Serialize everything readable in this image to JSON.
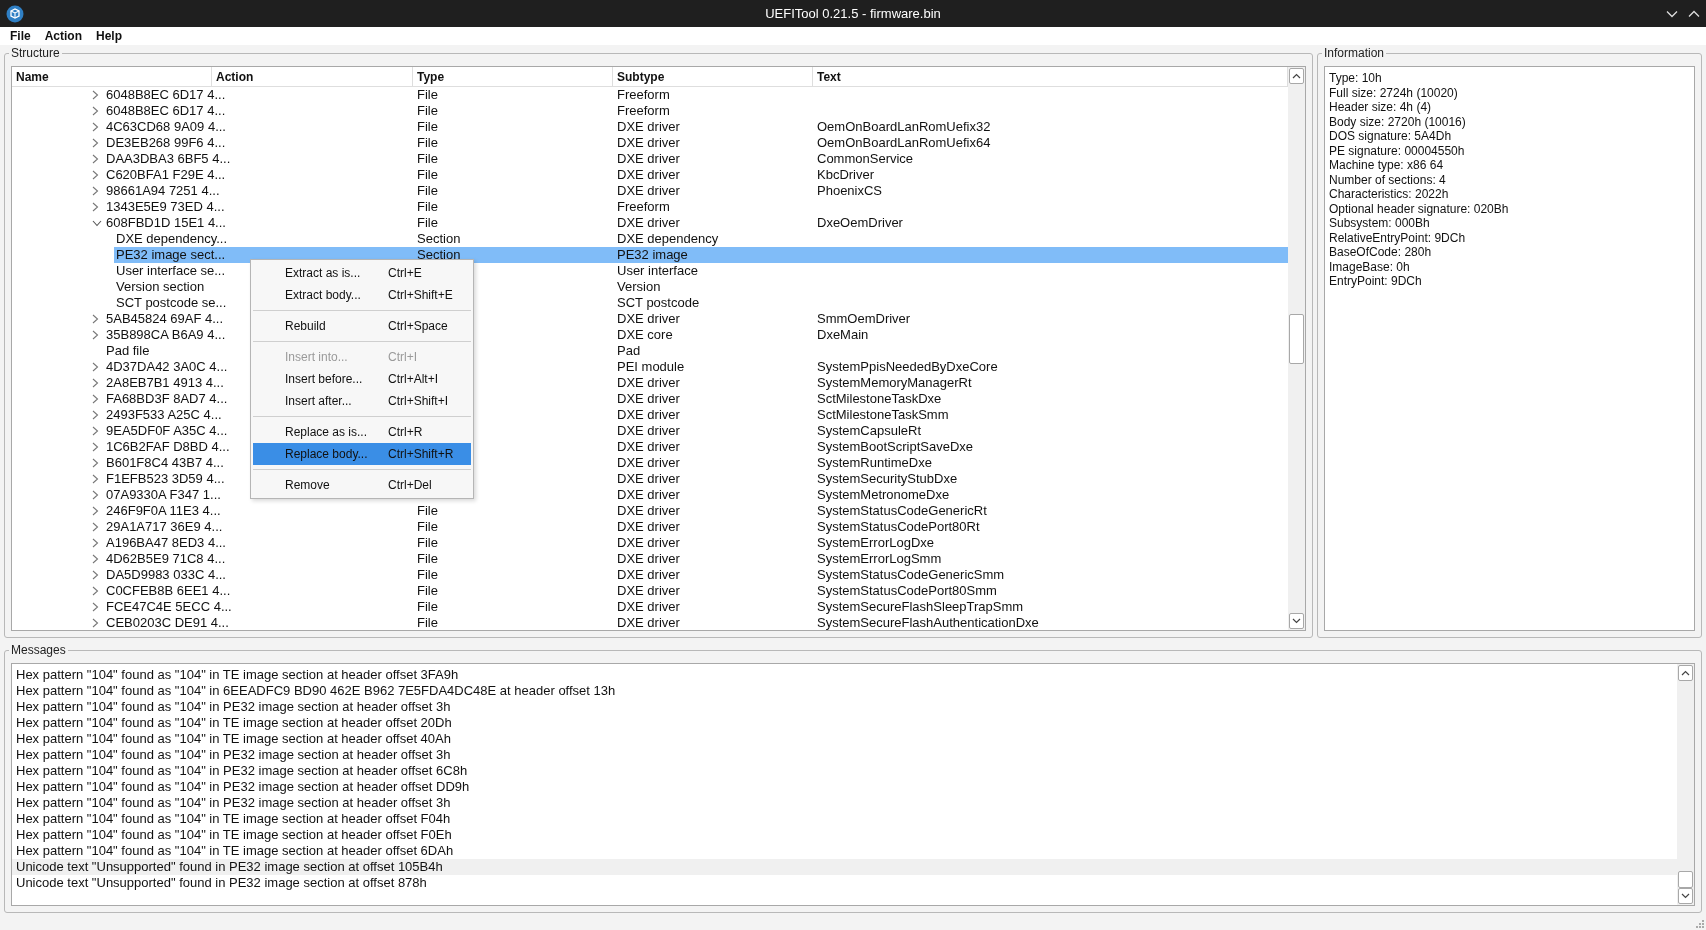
{
  "window": {
    "title": "UEFITool 0.21.5 - firmware.bin"
  },
  "menu_bar": [
    {
      "label": "File"
    },
    {
      "label": "Action"
    },
    {
      "label": "Help"
    }
  ],
  "structure": {
    "title": "Structure",
    "columns": [
      "Name",
      "Action",
      "Type",
      "Subtype",
      "Text"
    ],
    "rows": [
      {
        "name": "6048B8EC 6D17 4...",
        "type": "File",
        "subtype": "Freeform",
        "expanded": false,
        "selected": false
      },
      {
        "name": "6048B8EC 6D17 4...",
        "type": "File",
        "subtype": "Freeform",
        "expanded": false,
        "selected": false
      },
      {
        "name": "4C63CD68 9A09 4...",
        "type": "File",
        "subtype": "DXE driver",
        "text": "OemOnBoardLanRomUefix32",
        "expanded": false,
        "selected": false
      },
      {
        "name": "DE3EB268 99F6 4...",
        "type": "File",
        "subtype": "DXE driver",
        "text": "OemOnBoardLanRomUefix64",
        "expanded": false,
        "selected": false
      },
      {
        "name": "DAA3DBA3 6BF5 4...",
        "type": "File",
        "subtype": "DXE driver",
        "text": "CommonService",
        "expanded": false,
        "selected": false
      },
      {
        "name": "C620BFA1 F29E 4...",
        "type": "File",
        "subtype": "DXE driver",
        "text": "KbcDriver",
        "expanded": false,
        "selected": false
      },
      {
        "name": "98661A94 7251 4...",
        "type": "File",
        "subtype": "DXE driver",
        "text": "PhoenixCS",
        "expanded": false,
        "selected": false
      },
      {
        "name": "1343E5E9 73ED 4...",
        "type": "File",
        "subtype": "Freeform",
        "expanded": false,
        "selected": false
      },
      {
        "name": "608FBD1D 15E1 4...",
        "type": "File",
        "subtype": "DXE driver",
        "text": "DxeOemDriver",
        "expanded": true,
        "selected": false,
        "children": [
          {
            "name": "DXE dependency...",
            "type": "Section",
            "subtype": "DXE dependency",
            "selected": false
          },
          {
            "name": "PE32 image sect...",
            "type": "Section",
            "subtype": "PE32 image",
            "selected": true
          },
          {
            "name": "User interface se...",
            "subtype": "User interface",
            "selected": false
          },
          {
            "name": "Version section",
            "subtype": "Version",
            "selected": false
          },
          {
            "name": "SCT postcode se...",
            "subtype": "SCT postcode",
            "selected": false
          }
        ]
      },
      {
        "name": "5AB45824 69AF 4...",
        "subtype": "DXE driver",
        "text": "SmmOemDriver",
        "expanded": false,
        "selected": false
      },
      {
        "name": "35B898CA B6A9 4...",
        "subtype": "DXE core",
        "text": "DxeMain",
        "expanded": false,
        "selected": false
      },
      {
        "name": "Pad file",
        "subtype": "Pad",
        "selected": false
      },
      {
        "name": "4D37DA42 3A0C 4...",
        "subtype": "PEI module",
        "text": "SystemPpisNeededByDxeCore",
        "expanded": false,
        "selected": false
      },
      {
        "name": "2A8EB7B1 4913 4...",
        "subtype": "DXE driver",
        "text": "SystemMemoryManagerRt",
        "expanded": false,
        "selected": false
      },
      {
        "name": "FA68BD3F 8AD7 4...",
        "subtype": "DXE driver",
        "text": "SctMilestoneTaskDxe",
        "expanded": false,
        "selected": false
      },
      {
        "name": "2493F533 A25C 4...",
        "subtype": "DXE driver",
        "text": "SctMilestoneTaskSmm",
        "expanded": false,
        "selected": false
      },
      {
        "name": "9EA5DF0F A35C 4...",
        "subtype": "DXE driver",
        "text": "SystemCapsuleRt",
        "expanded": false,
        "selected": false
      },
      {
        "name": "1C6B2FAF D8BD 4...",
        "subtype": "DXE driver",
        "text": "SystemBootScriptSaveDxe",
        "expanded": false,
        "selected": false
      },
      {
        "name": "B601F8C4 43B7 4...",
        "subtype": "DXE driver",
        "text": "SystemRuntimeDxe",
        "expanded": false,
        "selected": false
      },
      {
        "name": "F1EFB523 3D59 4...",
        "subtype": "DXE driver",
        "text": "SystemSecurityStubDxe",
        "expanded": false,
        "selected": false
      },
      {
        "name": "07A9330A F347 1...",
        "subtype": "DXE driver",
        "text": "SystemMetronomeDxe",
        "expanded": false,
        "selected": false
      },
      {
        "name": "246F9F0A 11E3 4...",
        "type": "File",
        "subtype": "DXE driver",
        "text": "SystemStatusCodeGenericRt",
        "expanded": false,
        "selected": false
      },
      {
        "name": "29A1A717 36E9 4...",
        "type": "File",
        "subtype": "DXE driver",
        "text": "SystemStatusCodePort80Rt",
        "expanded": false,
        "selected": false
      },
      {
        "name": "A196BA47 8ED3 4...",
        "type": "File",
        "subtype": "DXE driver",
        "text": "SystemErrorLogDxe",
        "expanded": false,
        "selected": false
      },
      {
        "name": "4D62B5E9 71C8 4...",
        "type": "File",
        "subtype": "DXE driver",
        "text": "SystemErrorLogSmm",
        "expanded": false,
        "selected": false
      },
      {
        "name": "DA5D9983 033C 4...",
        "type": "File",
        "subtype": "DXE driver",
        "text": "SystemStatusCodeGenericSmm",
        "expanded": false,
        "selected": false
      },
      {
        "name": "C0CFEB8B 6EE1 4...",
        "type": "File",
        "subtype": "DXE driver",
        "text": "SystemStatusCodePort80Smm",
        "expanded": false,
        "selected": false
      },
      {
        "name": "FCE47C4E 5ECC 4...",
        "type": "File",
        "subtype": "DXE driver",
        "text": "SystemSecureFlashSleepTrapSmm",
        "expanded": false,
        "selected": false
      },
      {
        "name": "CEB0203C DE91 4...",
        "type": "File",
        "subtype": "DXE driver",
        "text": "SystemSecureFlashAuthenticationDxe",
        "expanded": false,
        "selected": false
      }
    ]
  },
  "context_menu": [
    {
      "kind": "item",
      "label": "Extract as is...",
      "shortcut": "Ctrl+E",
      "disabled": false,
      "selected": false
    },
    {
      "kind": "item",
      "label": "Extract body...",
      "shortcut": "Ctrl+Shift+E",
      "disabled": false,
      "selected": false
    },
    {
      "kind": "separator"
    },
    {
      "kind": "item",
      "label": "Rebuild",
      "shortcut": "Ctrl+Space",
      "disabled": false,
      "selected": false
    },
    {
      "kind": "separator"
    },
    {
      "kind": "item",
      "label": "Insert into...",
      "shortcut": "Ctrl+I",
      "disabled": true,
      "selected": false
    },
    {
      "kind": "item",
      "label": "Insert before...",
      "shortcut": "Ctrl+Alt+I",
      "disabled": false,
      "selected": false
    },
    {
      "kind": "item",
      "label": "Insert after...",
      "shortcut": "Ctrl+Shift+I",
      "disabled": false,
      "selected": false
    },
    {
      "kind": "separator"
    },
    {
      "kind": "item",
      "label": "Replace as is...",
      "shortcut": "Ctrl+R",
      "disabled": false,
      "selected": false
    },
    {
      "kind": "item",
      "label": "Replace body...",
      "shortcut": "Ctrl+Shift+R",
      "disabled": false,
      "selected": true
    },
    {
      "kind": "separator"
    },
    {
      "kind": "item",
      "label": "Remove",
      "shortcut": "Ctrl+Del",
      "disabled": false,
      "selected": false
    }
  ],
  "information": {
    "title": "Information",
    "lines": [
      "Type: 10h",
      "Full size: 2724h (10020)",
      "Header size: 4h (4)",
      "Body size: 2720h (10016)",
      "DOS signature: 5A4Dh",
      "PE signature: 00004550h",
      "Machine type: x86 64",
      "Number of sections: 4",
      "Characteristics: 2022h",
      "Optional header signature: 020Bh",
      "Subsystem: 000Bh",
      "RelativeEntryPoint: 9DCh",
      "BaseOfCode: 280h",
      "ImageBase: 0h",
      "EntryPoint: 9DCh"
    ]
  },
  "messages": {
    "title": "Messages",
    "items": [
      {
        "text": "Hex pattern \"104\" found as \"104\" in TE image section at header offset 3FA9h",
        "selected": false
      },
      {
        "text": "Hex pattern \"104\" found as \"104\" in 6EEADFC9 BD90 462E B962 7E5FDA4DC48E at header offset 13h",
        "selected": false
      },
      {
        "text": "Hex pattern \"104\" found as \"104\" in PE32 image section at header offset 3h",
        "selected": false
      },
      {
        "text": "Hex pattern \"104\" found as \"104\" in TE image section at header offset 20Dh",
        "selected": false
      },
      {
        "text": "Hex pattern \"104\" found as \"104\" in TE image section at header offset 40Ah",
        "selected": false
      },
      {
        "text": "Hex pattern \"104\" found as \"104\" in PE32 image section at header offset 3h",
        "selected": false
      },
      {
        "text": "Hex pattern \"104\" found as \"104\" in PE32 image section at header offset 6C8h",
        "selected": false
      },
      {
        "text": "Hex pattern \"104\" found as \"104\" in PE32 image section at header offset DD9h",
        "selected": false
      },
      {
        "text": "Hex pattern \"104\" found as \"104\" in PE32 image section at header offset 3h",
        "selected": false
      },
      {
        "text": "Hex pattern \"104\" found as \"104\" in TE image section at header offset F04h",
        "selected": false
      },
      {
        "text": "Hex pattern \"104\" found as \"104\" in TE image section at header offset F0Eh",
        "selected": false
      },
      {
        "text": "Hex pattern \"104\" found as \"104\" in TE image section at header offset 6DAh",
        "selected": false
      },
      {
        "text": "Unicode text \"Unsupported\" found in PE32 image section at offset 105B4h",
        "selected": true
      },
      {
        "text": "Unicode text \"Unsupported\" found in PE32 image section at offset 878h",
        "selected": false
      }
    ]
  }
}
